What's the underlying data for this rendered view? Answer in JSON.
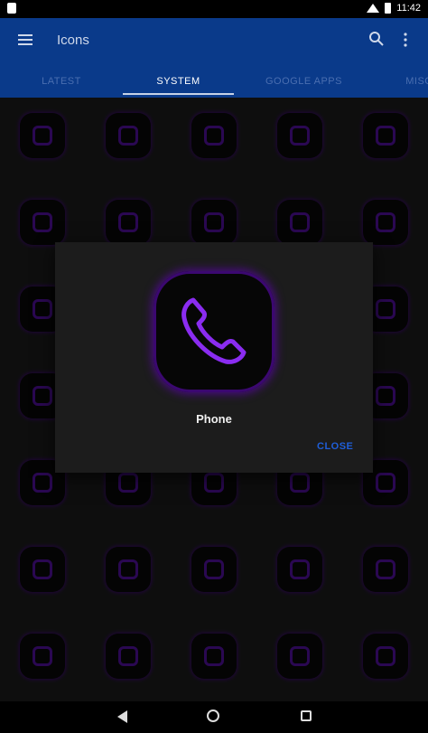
{
  "status_bar": {
    "time": "11:42",
    "icons": [
      "notification-icon",
      "wifi-icon",
      "battery-icon"
    ]
  },
  "app_bar": {
    "title": "Icons",
    "tabs": [
      {
        "label": "LATEST"
      },
      {
        "label": "SYSTEM",
        "selected": true
      },
      {
        "label": "GOOGLE APPS"
      },
      {
        "label": "MISC"
      }
    ],
    "icons": [
      "menu-icon",
      "search-icon",
      "overflow-icon"
    ]
  },
  "colors": {
    "app_bar": "#0a3a8a",
    "background": "#1b1b1b",
    "icon_glow": "#7b1fe0",
    "dialog": "#1c1c1c",
    "close_text": "#1f5ed8"
  },
  "grid_icons": [
    "contacts-icon",
    "calendar-icon",
    "camera-icon",
    "apps-icon",
    "contact-card-icon",
    "download-icon",
    "dropbox-icon",
    "play-store-icon",
    "excel-icon",
    "facebook-icon",
    "shop-icon",
    "app-icon",
    "app-icon",
    "app-icon",
    "video-icon",
    "docs-icon",
    "app-icon",
    "app-icon",
    "app-icon",
    "onenote-icon",
    "files-icon",
    "messages-icon",
    "phone-icon",
    "powerpoint-icon",
    "microphone-icon",
    "hub-icon",
    "chat-icon",
    "star-icon",
    "sync-icon",
    "video-file-icon",
    "power-icon",
    "player-icon",
    "lens-icon",
    "mic-icon",
    "word-icon"
  ],
  "dialog": {
    "app_name": "Phone",
    "icon": "phone-icon",
    "close_label": "CLOSE"
  },
  "nav_bar": {
    "icons": [
      "back-icon",
      "home-icon",
      "recents-icon"
    ]
  }
}
